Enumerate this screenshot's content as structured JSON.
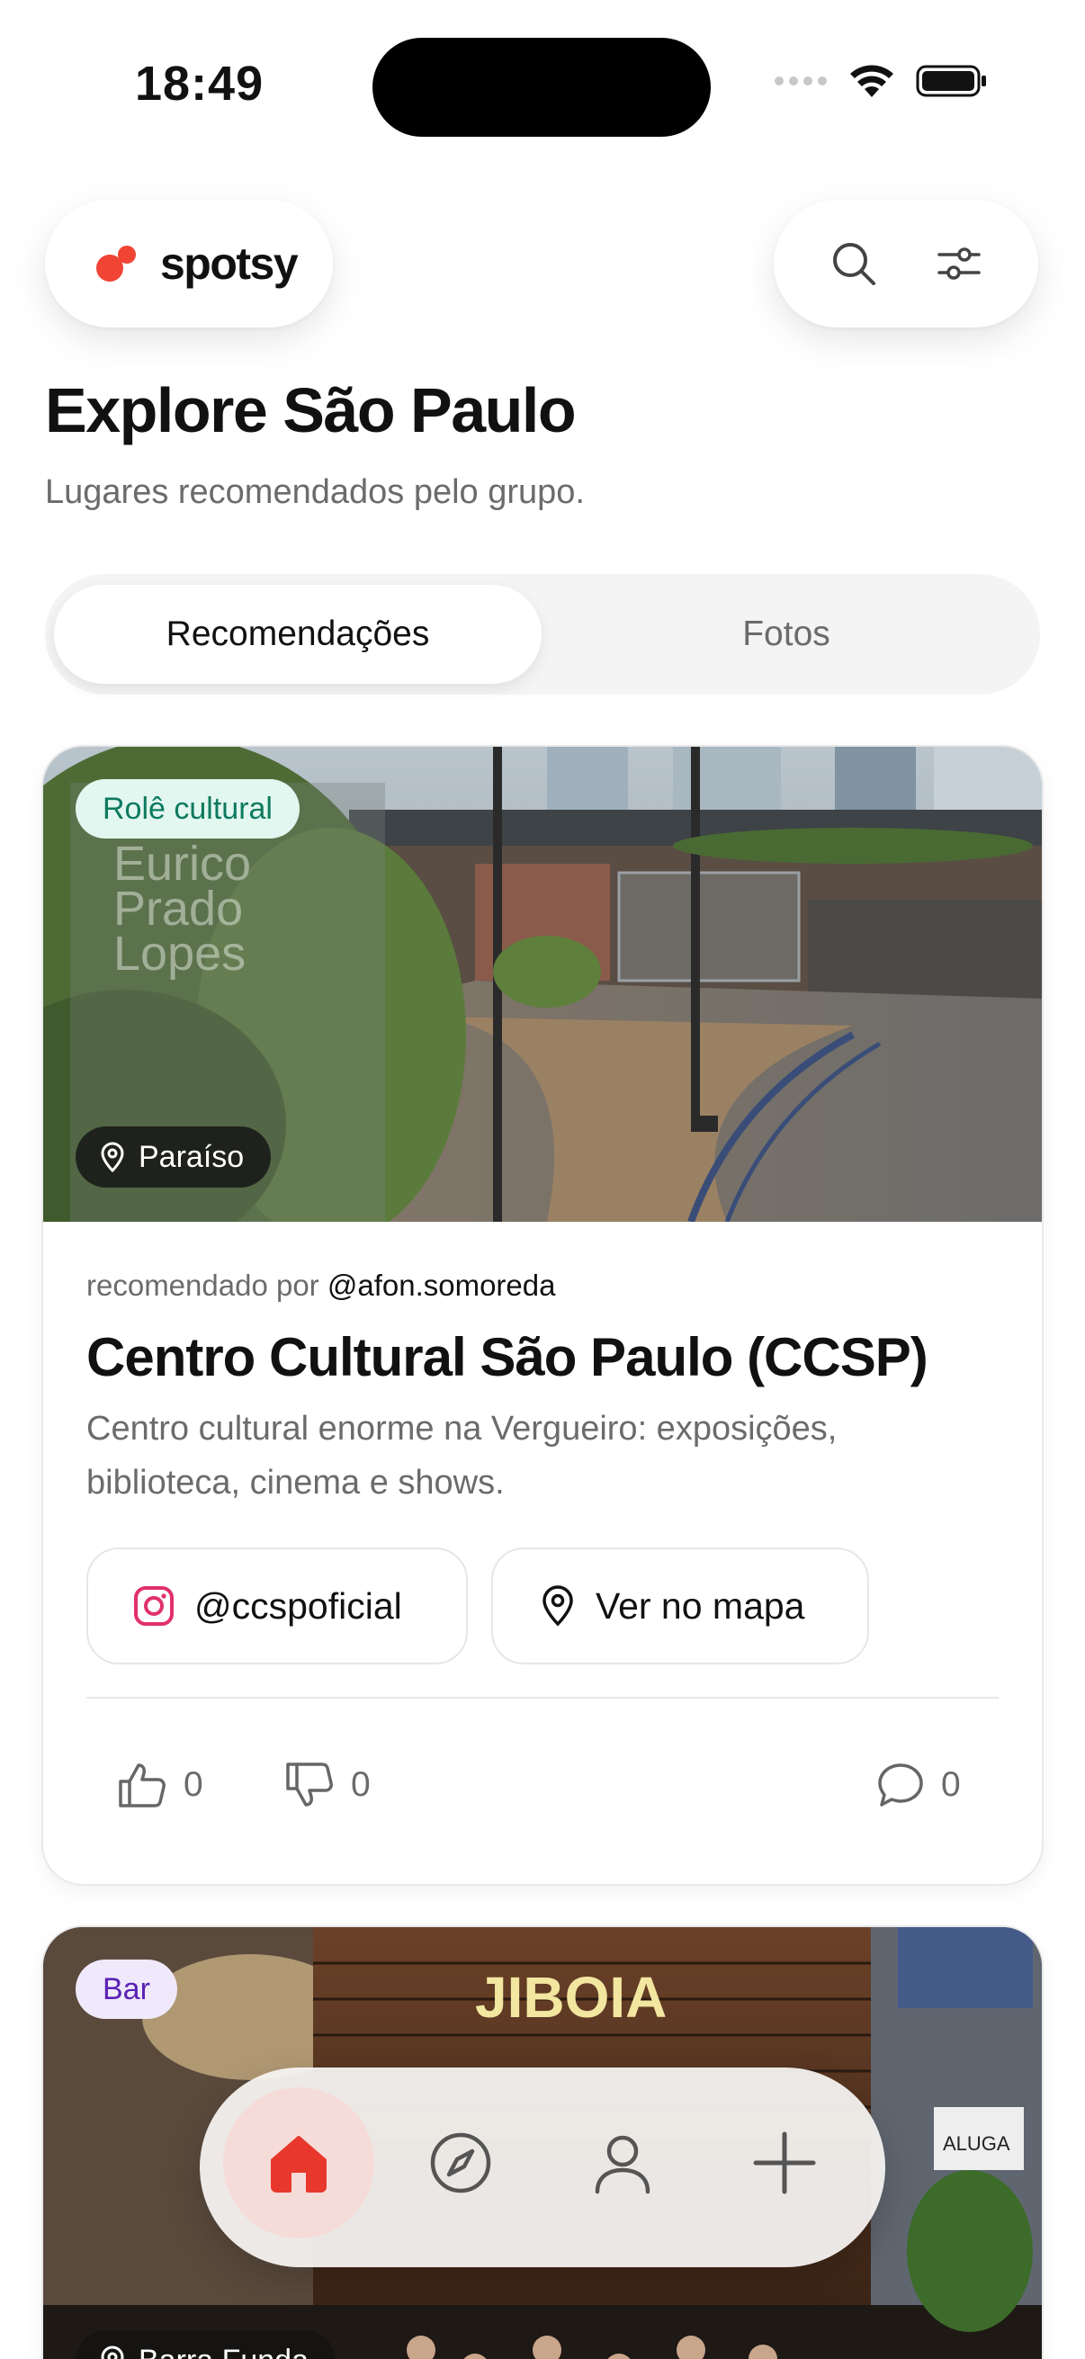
{
  "status_bar": {
    "time": "18:49"
  },
  "header": {
    "logo_text": "spotsy",
    "brand_color": "#f04434",
    "actions": [
      {
        "icon": "search-icon"
      },
      {
        "icon": "sliders-icon"
      }
    ]
  },
  "page": {
    "title": "Explore São Paulo",
    "subtitle": "Lugares recomendados pelo grupo."
  },
  "tabs": [
    {
      "label": "Recomendações",
      "active": true
    },
    {
      "label": "Fotos",
      "active": false
    }
  ],
  "cards": [
    {
      "category": "Rolê cultural",
      "location": "Paraíso",
      "recommended_prefix": "recomendado por",
      "recommended_by": "@afon.somoreda",
      "title": "Centro Cultural São Paulo (CCSP)",
      "description": "Centro cultural enorme na Vergueiro: exposições, biblioteca, cinema e shows.",
      "instagram": "@ccspoficial",
      "map_label": "Ver no mapa",
      "likes": "0",
      "dislikes": "0",
      "comments": "0",
      "photo_text": [
        "Eurico",
        "Prado",
        "Lopes"
      ]
    },
    {
      "category": "Bar",
      "location": "Barra Funda",
      "photo_text": [
        "JIBOIA",
        "ALUGA"
      ]
    }
  ],
  "bottom_nav": [
    {
      "icon": "home-icon",
      "active": true,
      "color": "#e8372c"
    },
    {
      "icon": "compass-icon",
      "active": false
    },
    {
      "icon": "user-icon",
      "active": false
    },
    {
      "icon": "plus-icon",
      "active": false
    }
  ]
}
